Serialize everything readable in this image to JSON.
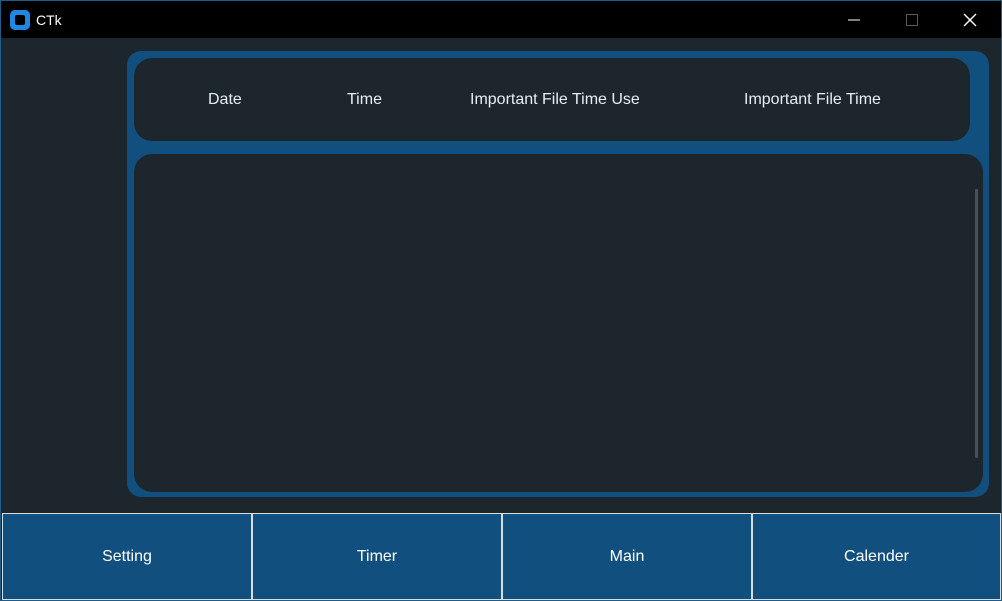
{
  "window": {
    "title": "CTk",
    "controls": {
      "minimize_icon": "minimize-icon",
      "maximize_icon": "maximize-icon",
      "close_icon": "close-icon"
    }
  },
  "table": {
    "headers": [
      "Date",
      "Time",
      "Important File Time Use",
      "Important File Time"
    ],
    "rows": []
  },
  "nav": {
    "setting": "Setting",
    "timer": "Timer",
    "main": "Main",
    "calender": "Calender"
  },
  "colors": {
    "accent": "#11507e",
    "background": "#1d262c",
    "titlebar": "#000000",
    "text": "#ffffff"
  }
}
